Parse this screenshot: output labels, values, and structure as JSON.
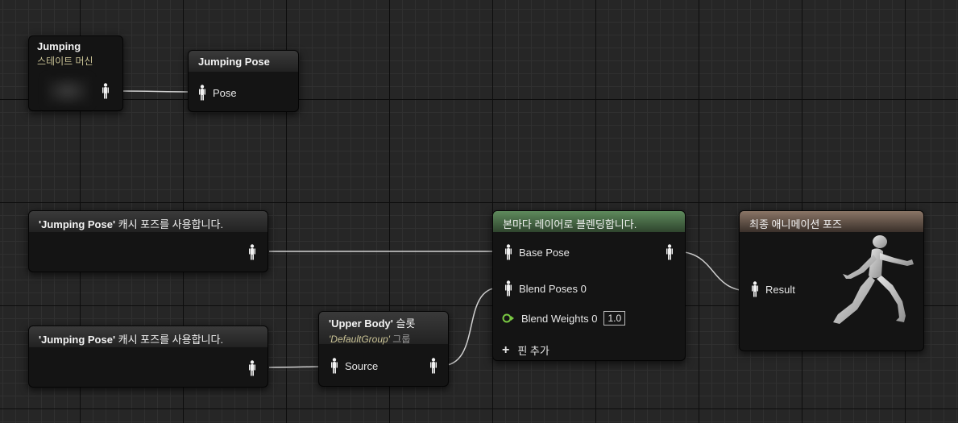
{
  "nodes": {
    "state_machine": {
      "title": "Jumping",
      "subtitle": "스테이트 머신"
    },
    "jumping_pose": {
      "title": "Jumping Pose",
      "pin_label": "Pose"
    },
    "cache1": {
      "title_bold": "'Jumping Pose'",
      "title_rest": " 캐시 포즈를 사용합니다."
    },
    "cache2": {
      "title_bold": "'Jumping Pose'",
      "title_rest": " 캐시 포즈를 사용합니다."
    },
    "slot": {
      "title_bold": "'Upper Body'",
      "title_rest": " 슬롯",
      "group_italic": "'DefaultGroup'",
      "group_word": " 그룹",
      "pin_label": "Source"
    },
    "blend": {
      "title": "본마다 레이어로 블렌딩합니다.",
      "base_pose": "Base Pose",
      "blend_poses": "Blend Poses 0",
      "blend_weights": "Blend Weights 0",
      "weight_value": "1.0",
      "add_pin": "핀 추가"
    },
    "result": {
      "title": "최종 애니메이션 포즈",
      "pin_label": "Result"
    }
  },
  "colors": {
    "wire": "#d0d0d0",
    "blend_header": "#5e8a5c",
    "result_header": "#8a7566",
    "weight_pin": "#7ac943"
  },
  "icons": {
    "pose_pin": "pose-figure-icon",
    "float_pin": "float-pin-icon",
    "add": "plus-icon",
    "mannequin": "running-mannequin-icon"
  }
}
